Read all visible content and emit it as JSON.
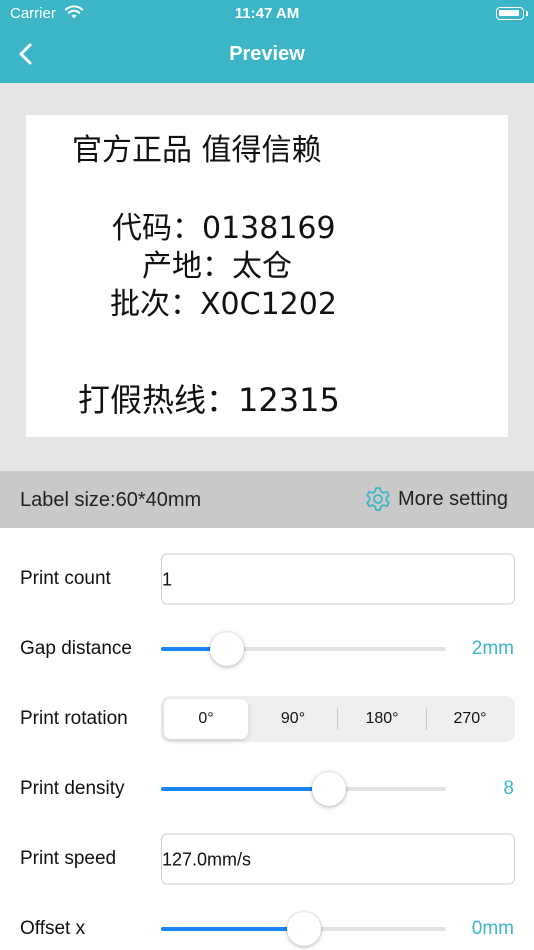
{
  "status_bar": {
    "carrier": "Carrier",
    "time": "11:47 AM"
  },
  "nav": {
    "title": "Preview"
  },
  "label_preview": {
    "line1": "官方正品 值得信赖",
    "line2": "代码：0138169",
    "line3": "产地：太仓",
    "line4": "批次：X0C1202",
    "line5": "打假热线：12315"
  },
  "info_bar": {
    "label_size": "Label size:60*40mm",
    "more_setting": "More setting"
  },
  "settings": {
    "print_count": {
      "label": "Print count",
      "value": "1"
    },
    "gap_distance": {
      "label": "Gap distance",
      "value": "2mm",
      "level": 0.23
    },
    "print_rotation": {
      "label": "Print rotation",
      "options": [
        "0°",
        "90°",
        "180°",
        "270°"
      ],
      "selected": "0°"
    },
    "print_density": {
      "label": "Print density",
      "value": "8",
      "level": 0.59
    },
    "print_speed": {
      "label": "Print speed",
      "value": "127.0mm/s"
    },
    "offset_x": {
      "label": "Offset x",
      "value": "0mm",
      "level": 0.5
    }
  },
  "colors": {
    "accent": "#3cb6c6",
    "slider_fill": "#1a84f5",
    "preview_bg": "#e5e5e5",
    "info_bar_bg": "#c9c9c9"
  },
  "icons": {
    "back": "chevron-left-icon",
    "settings": "gear-icon",
    "wifi": "wifi-icon",
    "battery": "battery-icon"
  }
}
